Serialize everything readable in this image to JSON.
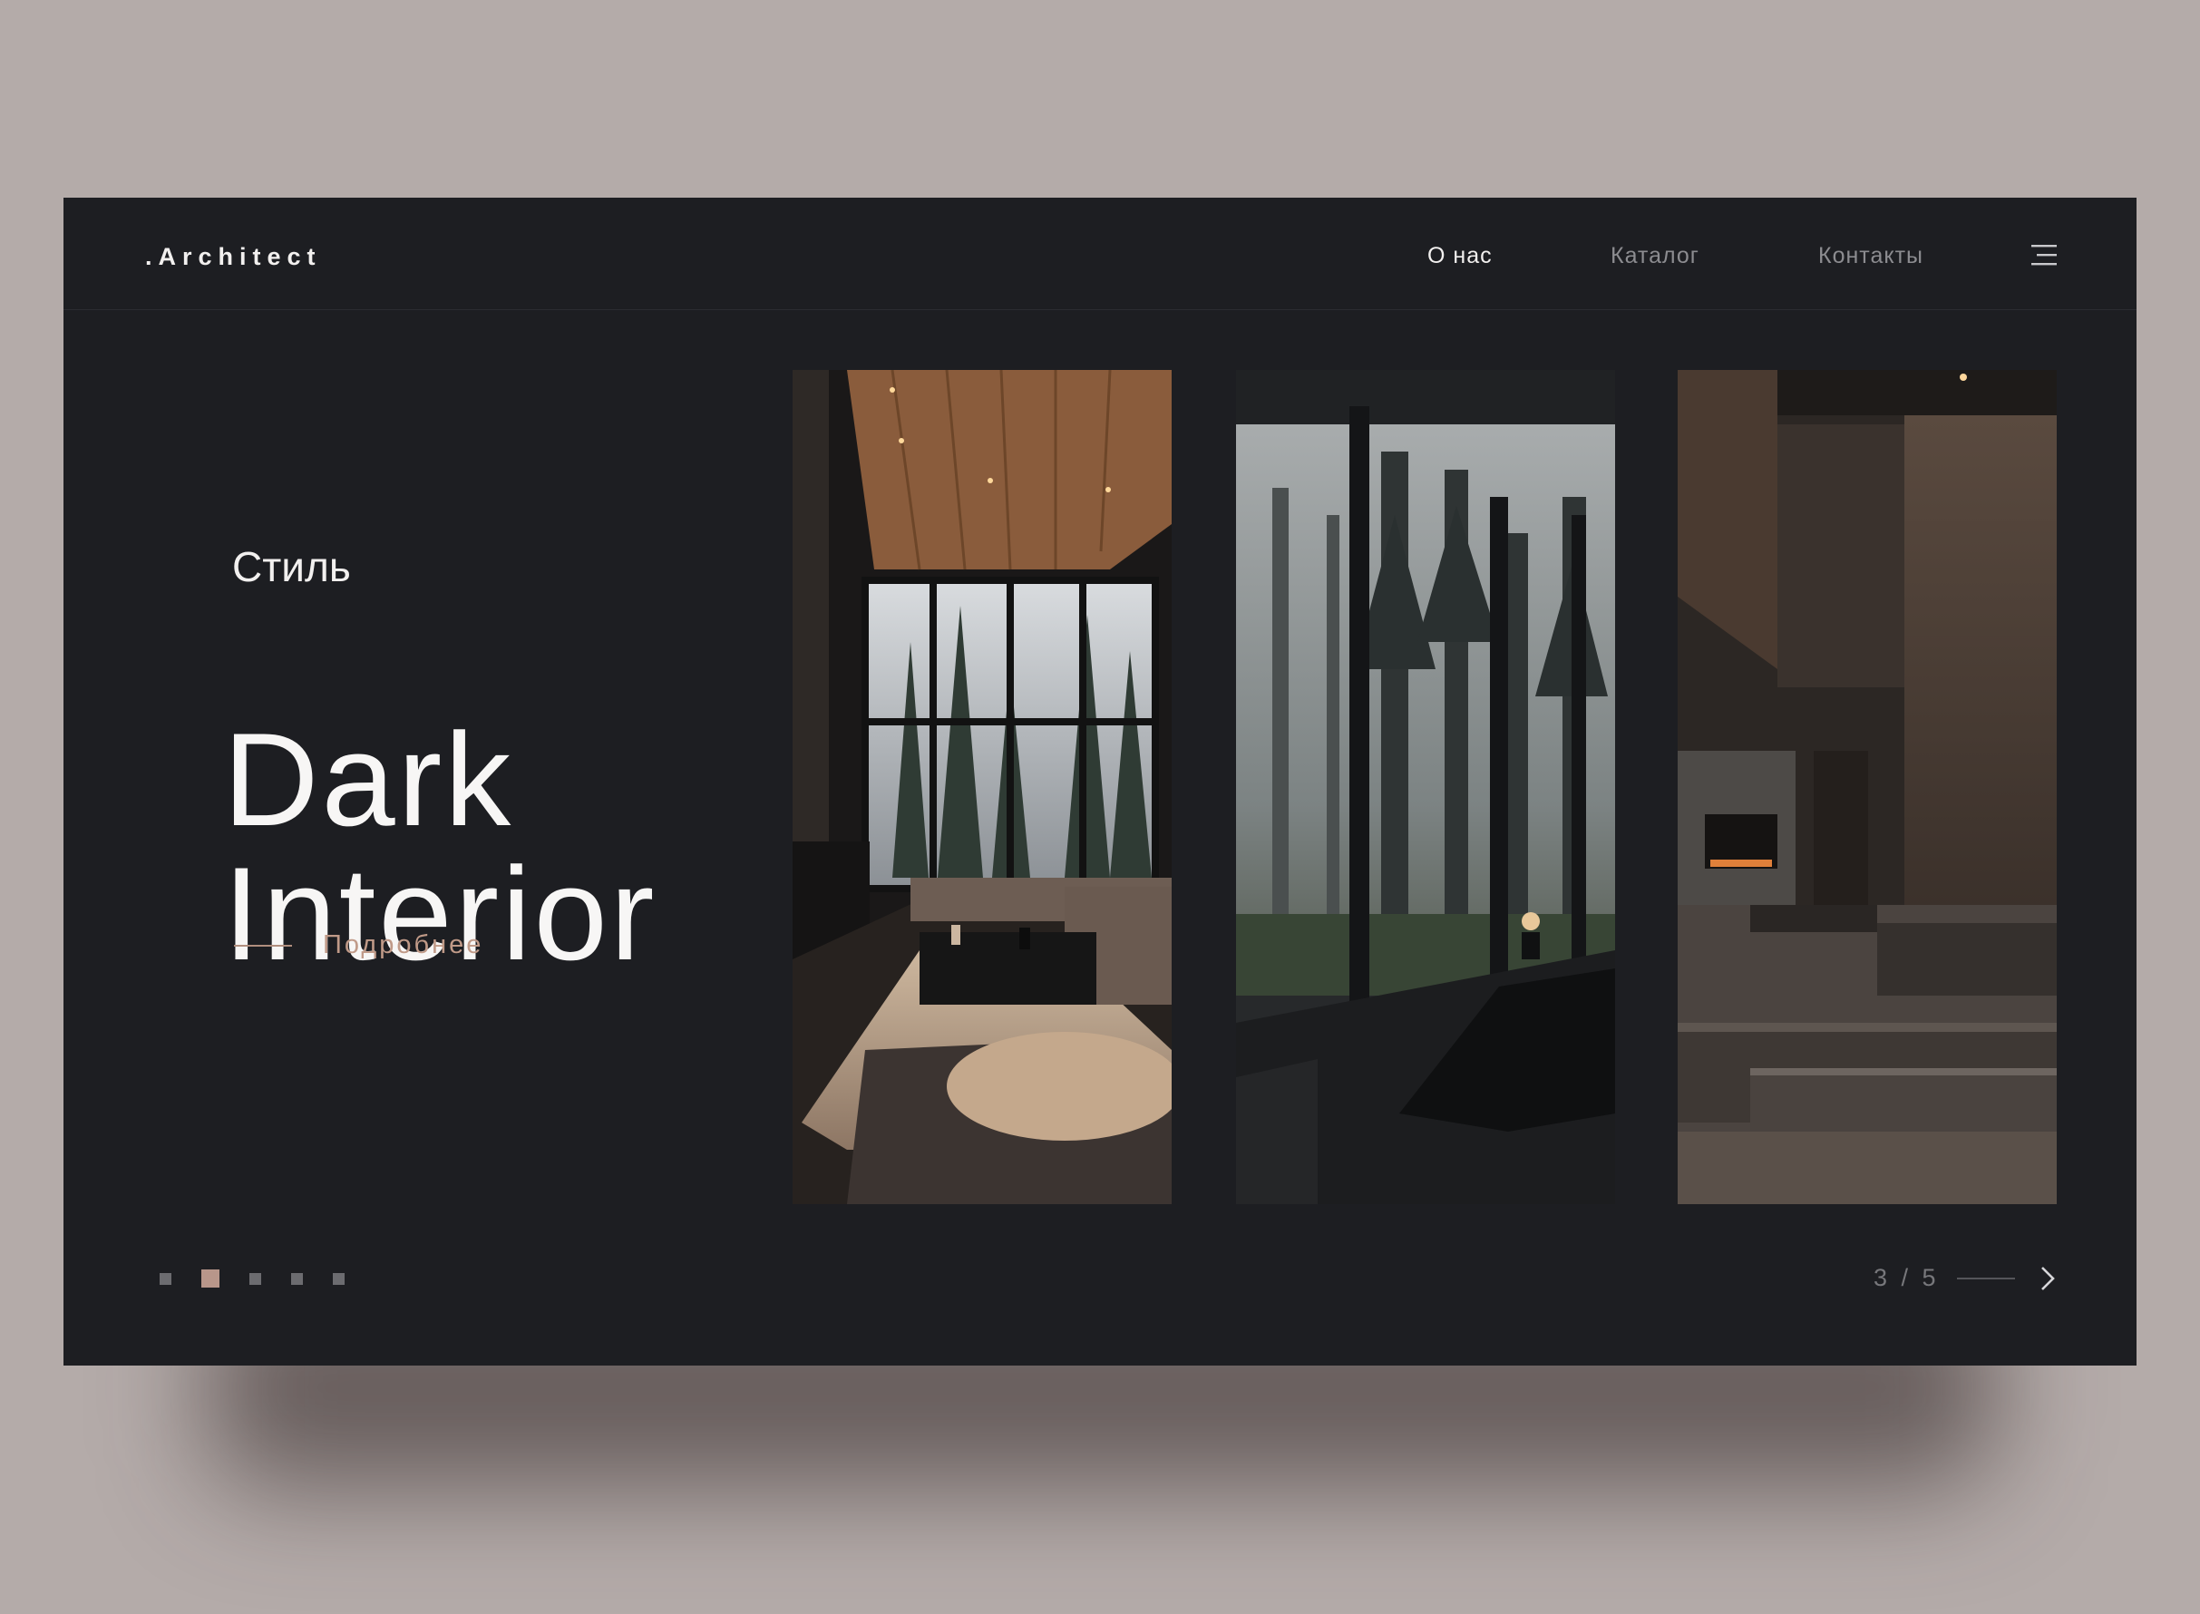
{
  "brand": {
    "logo": ".Architect"
  },
  "nav": {
    "items": [
      {
        "label": "О нас",
        "active": true
      },
      {
        "label": "Каталог",
        "active": false
      },
      {
        "label": "Контакты",
        "active": false
      }
    ],
    "menu_icon": "hamburger-menu-icon"
  },
  "hero": {
    "subtitle": "Стиль",
    "title_line1": "Dark",
    "title_line2": "Interior",
    "more_label": "Подробнее"
  },
  "gallery": {
    "images": [
      {
        "name": "living-room-photo"
      },
      {
        "name": "foggy-forest-bedroom-photo"
      },
      {
        "name": "concrete-stairs-interior-photo"
      }
    ]
  },
  "pagination": {
    "total_dots": 5,
    "active_dot": 2,
    "counter": "3 / 5",
    "next_icon": "chevron-right-icon"
  },
  "colors": {
    "background": "#b4aba9",
    "panel": "#1d1e22",
    "accent": "#b8968a",
    "text_primary": "#f2f0ef",
    "text_muted": "#8c8c90"
  }
}
